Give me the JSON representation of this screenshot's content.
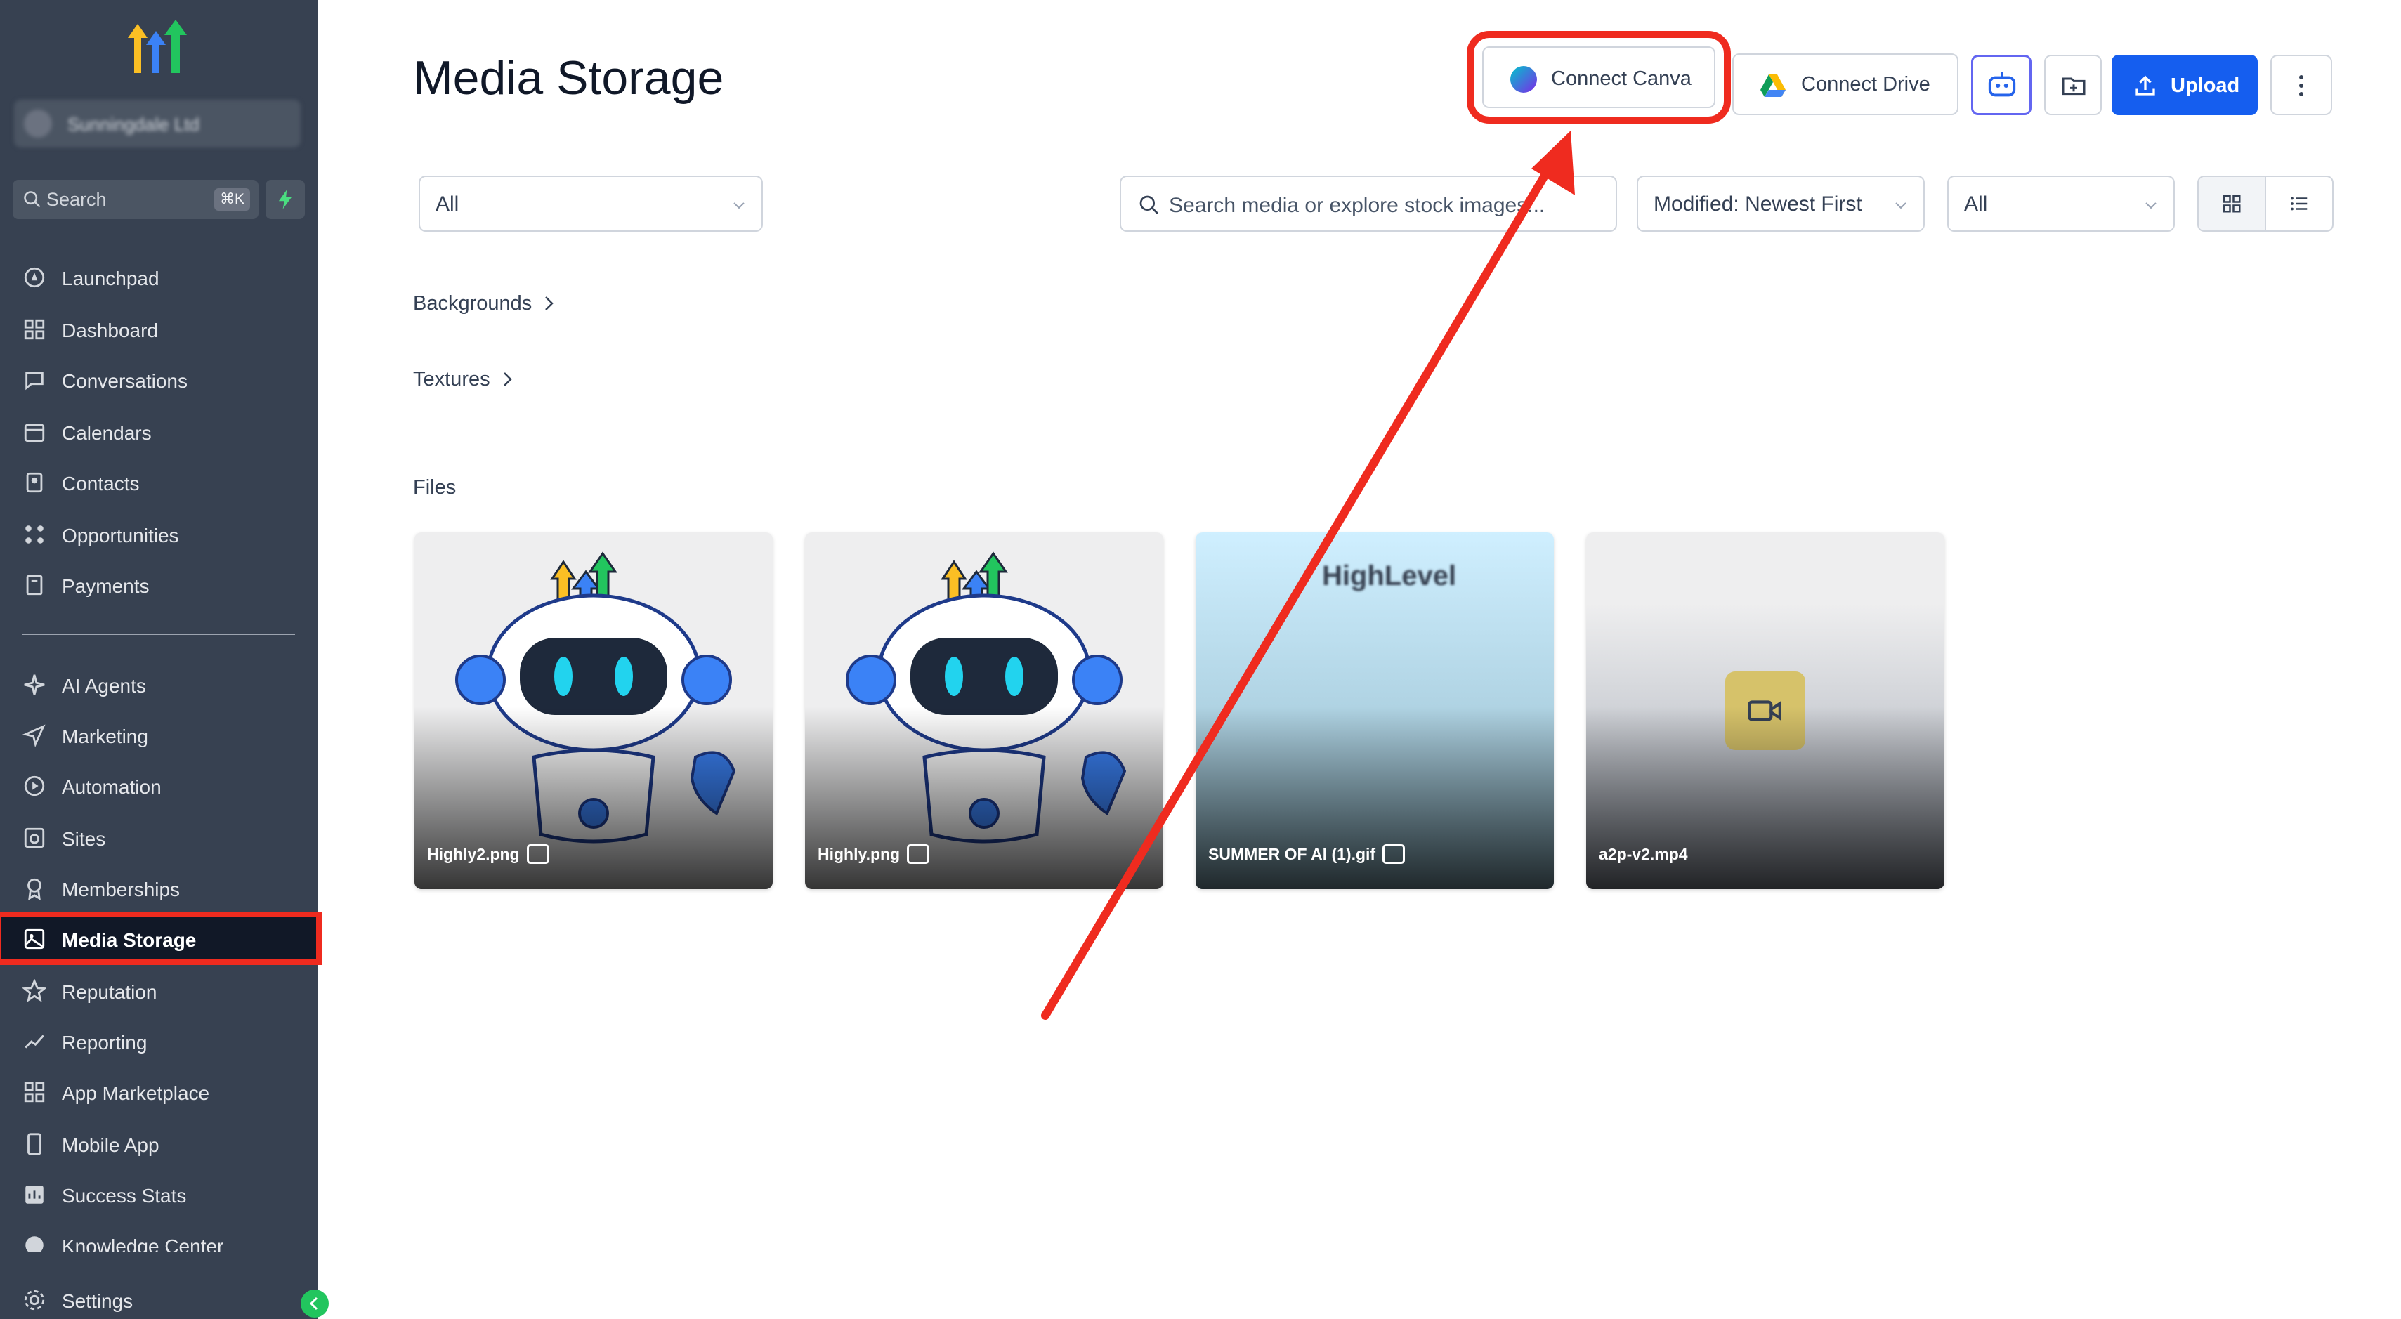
{
  "colors": {
    "sidebar": "#374151",
    "accent": "#155eef",
    "highlight": "#ef2b1f"
  },
  "sidebar": {
    "account_name": "Sunningdale Ltd",
    "search_label": "Search",
    "search_shortcut": "⌘K",
    "items": [
      {
        "label": "Launchpad",
        "icon": "rocket-icon"
      },
      {
        "label": "Dashboard",
        "icon": "grid-icon"
      },
      {
        "label": "Conversations",
        "icon": "chat-icon"
      },
      {
        "label": "Calendars",
        "icon": "calendar-icon"
      },
      {
        "label": "Contacts",
        "icon": "contacts-icon"
      },
      {
        "label": "Opportunities",
        "icon": "opportunities-icon"
      },
      {
        "label": "Payments",
        "icon": "payments-icon"
      },
      {
        "label": "AI Agents",
        "icon": "sparkle-icon"
      },
      {
        "label": "Marketing",
        "icon": "send-icon"
      },
      {
        "label": "Automation",
        "icon": "automation-icon"
      },
      {
        "label": "Sites",
        "icon": "sites-icon"
      },
      {
        "label": "Memberships",
        "icon": "award-icon"
      },
      {
        "label": "Media Storage",
        "icon": "image-icon"
      },
      {
        "label": "Reputation",
        "icon": "star-icon"
      },
      {
        "label": "Reporting",
        "icon": "trend-icon"
      },
      {
        "label": "App Marketplace",
        "icon": "apps-icon"
      },
      {
        "label": "Mobile App",
        "icon": "phone-icon"
      },
      {
        "label": "Success Stats",
        "icon": "stats-icon"
      },
      {
        "label": "Knowledge Center",
        "icon": "info-icon"
      },
      {
        "label": "Settings",
        "icon": "gear-icon"
      }
    ]
  },
  "header": {
    "title": "Media Storage",
    "connect_canva": "Connect Canva",
    "connect_drive": "Connect Drive",
    "upload": "Upload"
  },
  "filters": {
    "type_filter": "All",
    "search_placeholder": "Search media or explore stock images...",
    "sort": "Modified: Newest First",
    "kind_filter": "All"
  },
  "folders": [
    "Backgrounds",
    "Textures"
  ],
  "files_heading": "Files",
  "files": [
    {
      "name": "Highly2.png"
    },
    {
      "name": "Highly.png"
    },
    {
      "name": "SUMMER OF AI (1).gif",
      "preview_text": "HighLevel"
    },
    {
      "name": "a2p-v2.mp4"
    }
  ]
}
